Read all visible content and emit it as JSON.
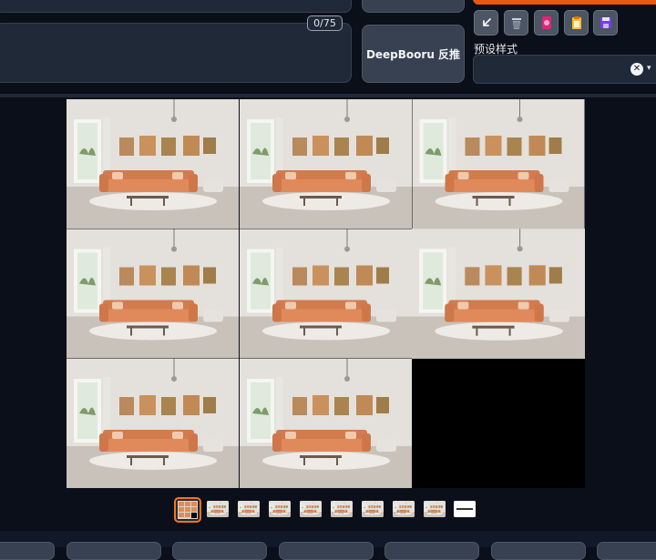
{
  "prompt": {
    "counter": "0/75"
  },
  "buttons": {
    "deepbooru": "DeepBooru 反推"
  },
  "toolbar": {
    "icons": [
      "arrow-down-left-icon",
      "trash-icon",
      "pink-card-icon",
      "clipboard-icon",
      "save-icon"
    ]
  },
  "styles": {
    "label": "预设样式",
    "clear_symbol": "✕",
    "caret_symbol": "▾"
  },
  "gallery": {
    "images": 8,
    "selected_thumbnail": 0
  },
  "colors": {
    "accent": "#f97316",
    "bg": "#0b0f19",
    "panel": "#1f2937",
    "sofa": "#e08a5c"
  }
}
